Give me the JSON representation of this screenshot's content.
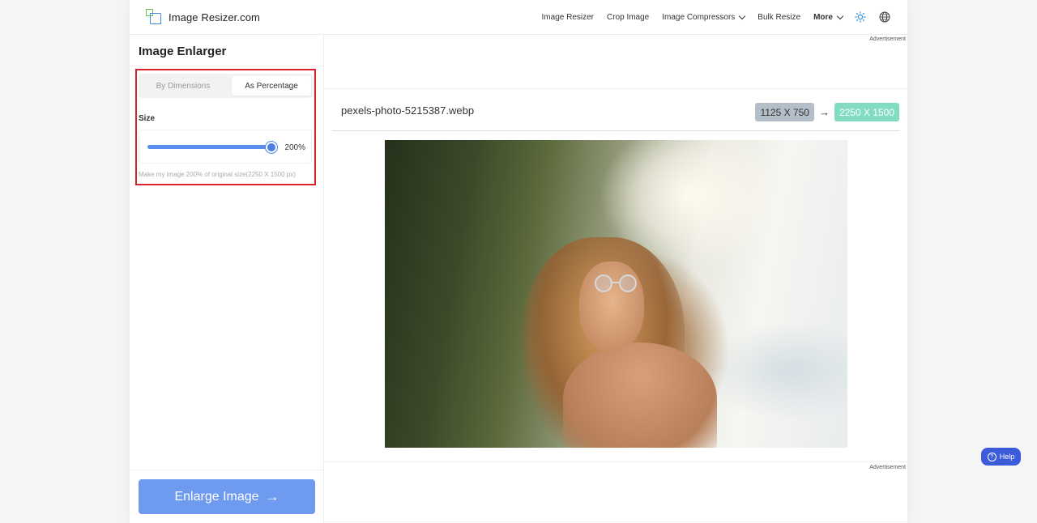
{
  "brand": {
    "name": "Image Resizer.com",
    "logo_icon": "resize-logo-icon"
  },
  "nav": {
    "items": [
      {
        "label": "Image Resizer"
      },
      {
        "label": "Crop Image"
      },
      {
        "label": "Image Compressors",
        "has_dropdown": true
      },
      {
        "label": "Bulk Resize"
      },
      {
        "label": "More",
        "has_dropdown": true
      }
    ],
    "theme_icon": "sun-icon",
    "language_icon": "globe-icon"
  },
  "sidebar": {
    "title": "Image Enlarger",
    "tabs": [
      {
        "label": "By Dimensions",
        "active": false
      },
      {
        "label": "As Percentage",
        "active": true
      }
    ],
    "size_label": "Size",
    "slider": {
      "value_label": "200%",
      "fill_fraction": 1.0
    },
    "hint": "Make my image 200% of original size(2250 X 1500 px)",
    "enlarge_button": "Enlarge Image",
    "enlarge_arrow": "→"
  },
  "main": {
    "ad_top": "Advertisement",
    "file_name": "pexels-photo-5215387.webp",
    "original_dims": "1125 X 750",
    "arrow": "→",
    "new_dims": "2250 X 1500",
    "ad_bottom": "Advertisement"
  },
  "help": {
    "label": "Help"
  },
  "colors": {
    "accent": "#5b8def",
    "button": "#6e9af0",
    "highlight": "#d8222a",
    "old_badge": "#b4bec8",
    "new_badge": "#82dcc1",
    "help": "#3b5bdb"
  }
}
